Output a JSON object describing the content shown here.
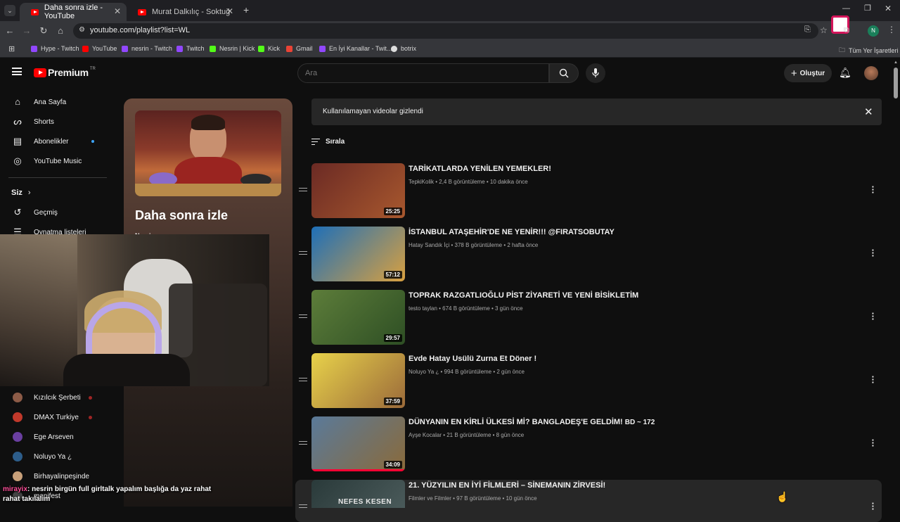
{
  "browser": {
    "tabs": [
      {
        "title": "Daha sonra izle - YouTube",
        "active": true
      },
      {
        "title": "Murat Dalkılıç - Soktuğu Durum",
        "active": false
      }
    ],
    "url": "youtube.com/playlist?list=WL",
    "profile_initial": "N",
    "bookmarks": [
      {
        "label": "Hype - Twitch",
        "color": "#9147ff"
      },
      {
        "label": "YouTube",
        "color": "#ff0000"
      },
      {
        "label": "nesrin - Twitch",
        "color": "#9147ff"
      },
      {
        "label": "Twitch",
        "color": "#9147ff"
      },
      {
        "label": "Nesrin | Kick",
        "color": "#53fc18"
      },
      {
        "label": "Kick",
        "color": "#53fc18"
      },
      {
        "label": "Gmail",
        "color": "#ea4335"
      },
      {
        "label": "En İyi Kanallar - Twit...",
        "color": "#9147ff"
      },
      {
        "label": "botrix",
        "color": "#dddddd"
      }
    ],
    "all_bookmarks": "Tüm Yer İşaretleri"
  },
  "yt": {
    "logo": "Premium",
    "logo_region": "TR",
    "search_placeholder": "Ara",
    "create_label": "Oluştur",
    "sidebar": {
      "items": [
        {
          "label": "Ana Sayfa",
          "icon": "home-icon"
        },
        {
          "label": "Shorts",
          "icon": "shorts-icon"
        },
        {
          "label": "Abonelikler",
          "icon": "subscriptions-icon"
        },
        {
          "label": "YouTube Music",
          "icon": "music-icon"
        }
      ],
      "you_label": "Siz",
      "you_items": [
        {
          "label": "Geçmiş",
          "icon": "history-icon"
        },
        {
          "label": "Oynatma listeleri",
          "icon": "playlists-icon"
        }
      ],
      "channels": [
        {
          "label": "Kızılcık Şerbeti",
          "color": "#8c5b47"
        },
        {
          "label": "DMAX Turkiye",
          "color": "#c0392b"
        },
        {
          "label": "Ege Arseven",
          "color": "#6a3fa0"
        },
        {
          "label": "Noluyo Ya ¿",
          "color": "#2d5d8a"
        },
        {
          "label": "Birhayalinpeşinde",
          "color": "#c8a07a"
        },
        {
          "label": "manifest",
          "color": "#444444"
        }
      ]
    },
    "playlist": {
      "title": "Daha sonra izle",
      "owner": "Nesrin"
    },
    "notice": "Kullanılamayan videolar gizlendi",
    "sort_label": "Sırala",
    "videos": [
      {
        "title": "TARİKATLARDA YENİLEN YEMEKLER!",
        "meta": "TepkiKolik • 2,4 B görüntüleme • 10 dakika önce",
        "duration": "25:25",
        "c1": "#6b2a24",
        "c2": "#a8582e"
      },
      {
        "title": "İSTANBUL ATAŞEHİR'DE NE YENİR!!! @FIRATSOBUTAY",
        "meta": "Hatay Sandık İçi • 378 B görüntüleme • 2 hafta önce",
        "duration": "57:12",
        "c1": "#1e6fb8",
        "c2": "#d8a040"
      },
      {
        "title": "TOPRAK RAZGATLIOĞLU PİST ZİYARETİ VE YENİ BİSİKLETİM",
        "meta": "testo taylan • 674 B görüntüleme • 3 gün önce",
        "duration": "29:57",
        "c1": "#5d7d3a",
        "c2": "#2e4f24"
      },
      {
        "title": "Evde Hatay Usülü Zurna Et Döner !",
        "meta": "Noluyo Ya ¿ • 994 B görüntüleme • 2 gün önce",
        "duration": "37:59",
        "c1": "#e8d24a",
        "c2": "#9b6a3a"
      },
      {
        "title": "DÜNYANIN EN KİRLİ ÜLKESİ Mİ? BANGLADEŞ'E GELDİM!",
        "title_suffix": "BD ~ 172",
        "meta": "Ayşe Kocalar • 21 B görüntüleme • 8 gün önce",
        "duration": "34:09",
        "c1": "#5a7a9a",
        "c2": "#8a6a3a"
      },
      {
        "title": "21. YÜZYILIN EN İYİ FİLMLERİ – SİNEMANIN ZİRVESİ!",
        "meta": "Filmler ve Filmler • 97 B görüntüleme • 10 gün önce",
        "duration": "",
        "c1": "#2a3a3a",
        "c2": "#4a5a5a"
      }
    ]
  },
  "overlay": {
    "chat_user": "mirayix",
    "chat_message": ": nesrin birgün full girltalk yapalım başlığa da yaz rahat rahat takılalım",
    "webcam_text": "NEFES KESEN"
  }
}
